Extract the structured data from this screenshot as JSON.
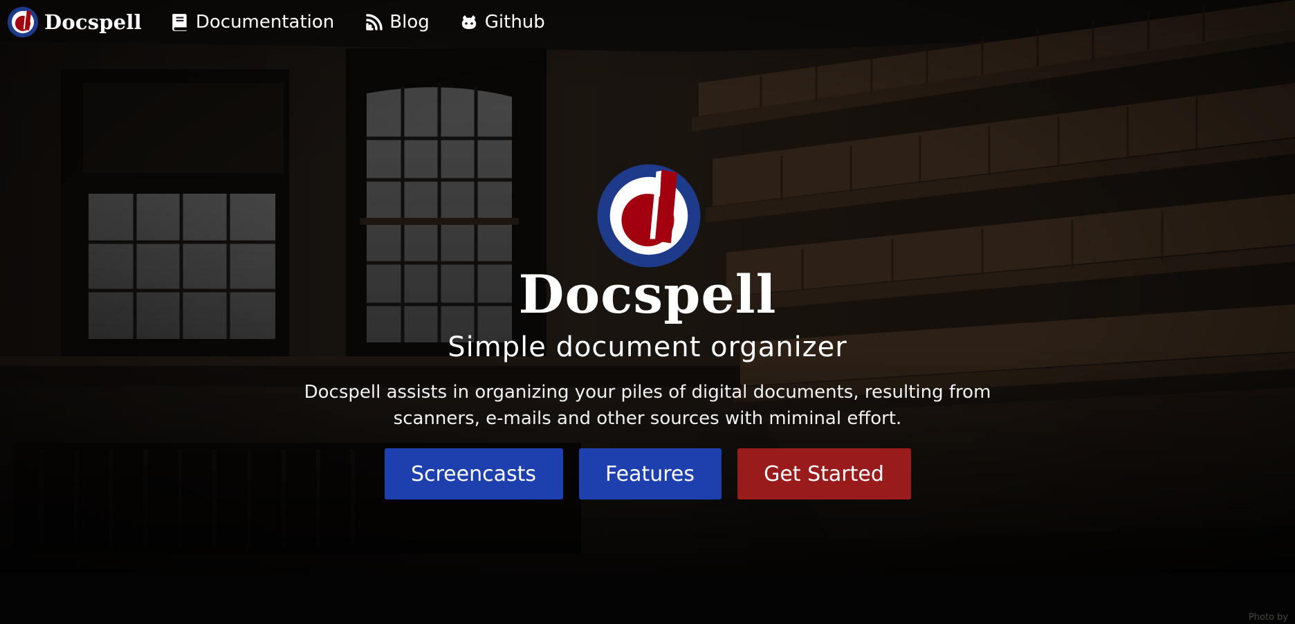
{
  "nav": {
    "brand": "Docspell",
    "links": [
      {
        "label": "Documentation",
        "icon": "book-icon"
      },
      {
        "label": "Blog",
        "icon": "blog-icon"
      },
      {
        "label": "Github",
        "icon": "github-icon"
      }
    ]
  },
  "hero": {
    "title": "Docspell",
    "subtitle": "Simple document organizer",
    "description": "Docspell assists in organizing your piles of digital documents, resulting from scanners, e-mails and other sources with miminal effort.",
    "buttons": [
      {
        "label": "Screencasts",
        "color": "#1e40af"
      },
      {
        "label": "Features",
        "color": "#1e40af"
      },
      {
        "label": "Get Started",
        "color": "#991b1b"
      }
    ]
  },
  "footer": {
    "photo_credit": "Photo by"
  },
  "colors": {
    "logo_ring": "#1e3a8a",
    "logo_accent": "#a3000f",
    "primary_button": "#1e40af",
    "cta_button": "#991b1b"
  }
}
